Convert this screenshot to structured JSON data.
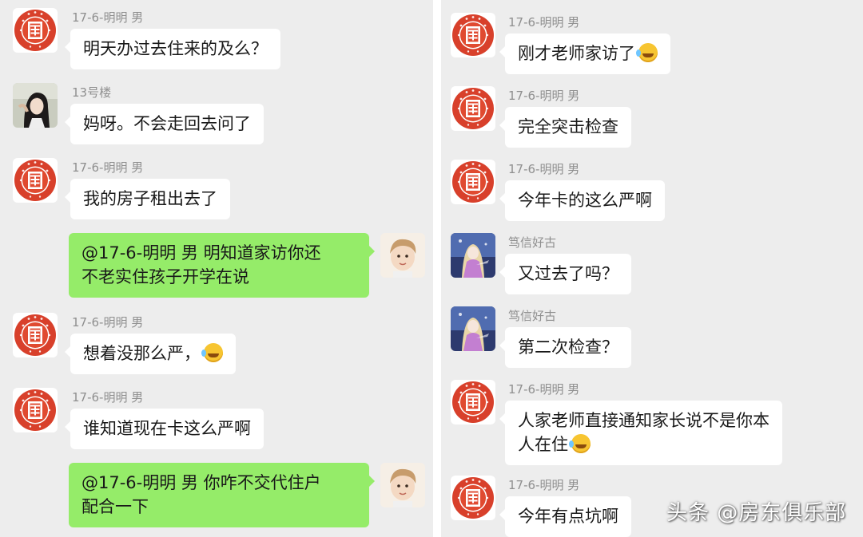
{
  "left_chat": {
    "messages": [
      {
        "type": "received",
        "avatar": "red-seal-logo",
        "sender": "17-6-明明 男",
        "text": "明天办过去住来的及么？",
        "emoji": false
      },
      {
        "type": "received",
        "avatar": "woman-photo",
        "sender": "13号楼",
        "text": "妈呀。不会走回去问了",
        "emoji": false
      },
      {
        "type": "received",
        "avatar": "red-seal-logo",
        "sender": "17-6-明明 男",
        "text": "我的房子租出去了",
        "emoji": false
      },
      {
        "type": "sent",
        "avatar": "child-photo",
        "line1": "@17-6-明明 男  明知道家访你还",
        "line2": "不老实住孩子开学在说"
      },
      {
        "type": "received",
        "avatar": "red-seal-logo",
        "sender": "17-6-明明 男",
        "text": "想着没那么严，",
        "emoji": true
      },
      {
        "type": "received",
        "avatar": "red-seal-logo",
        "sender": "17-6-明明 男",
        "text": "谁知道现在卡这么严啊",
        "emoji": false
      },
      {
        "type": "sent",
        "avatar": "child-photo",
        "line1": "@17-6-明明 男  你咋不交代住户",
        "line2": "配合一下"
      }
    ]
  },
  "right_chat": {
    "messages": [
      {
        "type": "received",
        "avatar": "red-seal-logo",
        "sender": "17-6-明明 男",
        "text": "刚才老师家访了",
        "emoji": true
      },
      {
        "type": "received",
        "avatar": "red-seal-logo",
        "sender": "17-6-明明 男",
        "text": "完全突击检查",
        "emoji": false
      },
      {
        "type": "received",
        "avatar": "red-seal-logo",
        "sender": "17-6-明明 男",
        "text": "今年卡的这么严啊",
        "emoji": false
      },
      {
        "type": "received",
        "avatar": "anime-girl",
        "sender": "笃信好古",
        "text": "又过去了吗？",
        "emoji": false
      },
      {
        "type": "received",
        "avatar": "anime-girl",
        "sender": "笃信好古",
        "text": "第二次检查？",
        "emoji": false
      },
      {
        "type": "received",
        "avatar": "red-seal-logo",
        "sender": "17-6-明明 男",
        "line1": "人家老师直接通知家长说不是你本",
        "line2": "人在住",
        "emoji": true
      },
      {
        "type": "received",
        "avatar": "red-seal-logo",
        "sender": "17-6-明明 男",
        "text": "今年有点坑啊",
        "emoji": false
      }
    ]
  },
  "watermark": "头条 @房东俱乐部",
  "colors": {
    "background": "#ededed",
    "sent_bubble": "#95ec69",
    "received_bubble": "#ffffff",
    "seal_red": "#d8402b"
  }
}
